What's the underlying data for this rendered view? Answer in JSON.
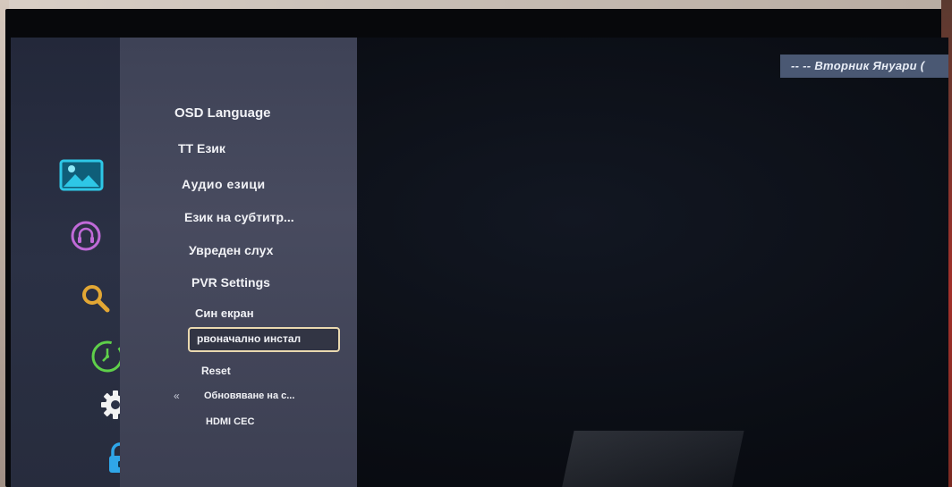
{
  "clock": {
    "text": "-- -- Вторник Януари ("
  },
  "sidebar": {
    "icons": [
      "picture-icon",
      "sound-icon",
      "search-icon",
      "timer-icon",
      "settings-icon",
      "lock-icon"
    ],
    "colors": {
      "picture": "#2ec7e6",
      "sound": "#c06ad8",
      "search": "#e3a734",
      "timer": "#5fd04a",
      "settings": "#f2f2f2",
      "lock": "#2fa6e8"
    }
  },
  "menu": {
    "items": [
      {
        "label": "OSD Language"
      },
      {
        "label": "TT Език"
      },
      {
        "label": "Аудио езици"
      },
      {
        "label": "Език на субтитр..."
      },
      {
        "label": "Увреден слух"
      },
      {
        "label": "PVR Settings"
      },
      {
        "label": "Син екран"
      },
      {
        "label": "рвоначално инстал",
        "selected": true
      },
      {
        "label": "Reset"
      },
      {
        "label": "Обновяване на с..."
      },
      {
        "label": "HDMI CEC"
      }
    ],
    "back_glyph": "«"
  }
}
